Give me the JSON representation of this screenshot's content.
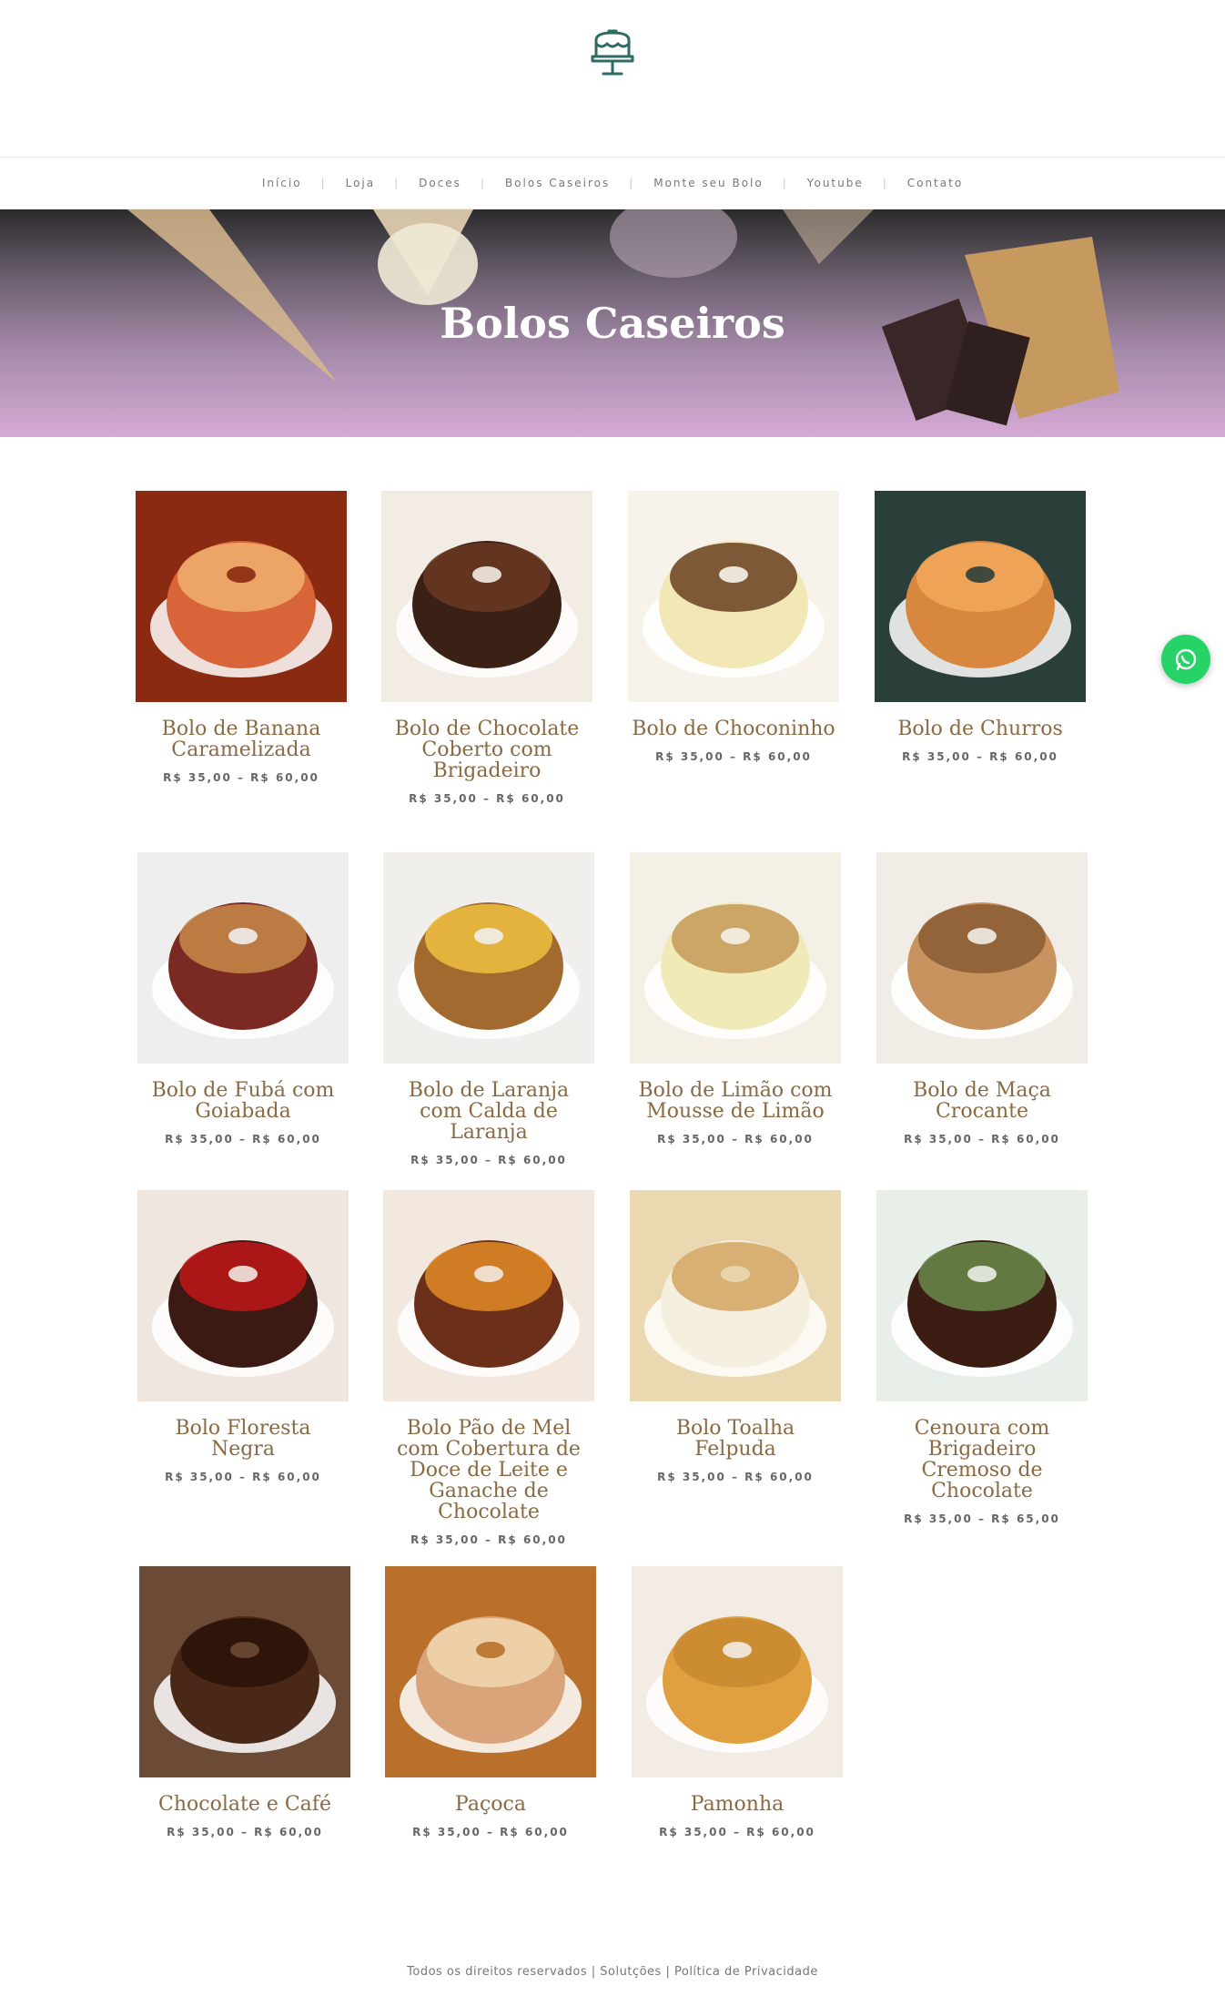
{
  "nav": [
    "Início",
    "Loja",
    "Doces",
    "Bolos Caseiros",
    "Monte seu Bolo",
    "Youtube",
    "Contato"
  ],
  "hero": {
    "title": "Bolos Caseiros"
  },
  "products": [
    {
      "title": "Bolo de Banana Caramelizada",
      "price": "R$ 35,00 – R$ 60,00"
    },
    {
      "title": "Bolo de Chocolate Coberto com Brigadeiro",
      "price": "R$ 35,00 – R$ 60,00"
    },
    {
      "title": "Bolo de Choconinho",
      "price": "R$ 35,00 – R$ 60,00"
    },
    {
      "title": "Bolo de Churros",
      "price": "R$ 35,00 – R$ 60,00"
    },
    {
      "title": "Bolo de Fubá com Goiabada",
      "price": "R$ 35,00 – R$ 60,00"
    },
    {
      "title": "Bolo de Laranja com Calda de Laranja",
      "price": "R$ 35,00 – R$ 60,00"
    },
    {
      "title": "Bolo de Limão com Mousse de Limão",
      "price": "R$ 35,00 – R$ 60,00"
    },
    {
      "title": "Bolo de Maça Crocante",
      "price": "R$ 35,00 – R$ 60,00"
    },
    {
      "title": "Bolo Floresta Negra",
      "price": "R$ 35,00 – R$ 60,00"
    },
    {
      "title": "Bolo Pão de Mel com Cobertura de Doce de Leite e Ganache de Chocolate",
      "price": "R$ 35,00 – R$ 60,00"
    },
    {
      "title": "Bolo Toalha Felpuda",
      "price": "R$ 35,00 – R$ 60,00"
    },
    {
      "title": "Cenoura com Brigadeiro Cremoso de Chocolate",
      "price": "R$ 35,00 – R$ 65,00"
    },
    {
      "title": "Chocolate e Café",
      "price": "R$ 35,00 – R$ 60,00"
    },
    {
      "title": "Paçoca",
      "price": "R$ 35,00 – R$ 60,00"
    },
    {
      "title": "Pamonha",
      "price": "R$ 35,00 – R$ 60,00"
    }
  ],
  "footer": {
    "rights": "Todos os direitos reservados",
    "solutions": "Solutções",
    "privacy": "Política de Privacidade",
    "sep": "|"
  },
  "colors": {
    "title": "#8a6a42",
    "whatsapp": "#25d366",
    "logo": "#2e6b62"
  }
}
